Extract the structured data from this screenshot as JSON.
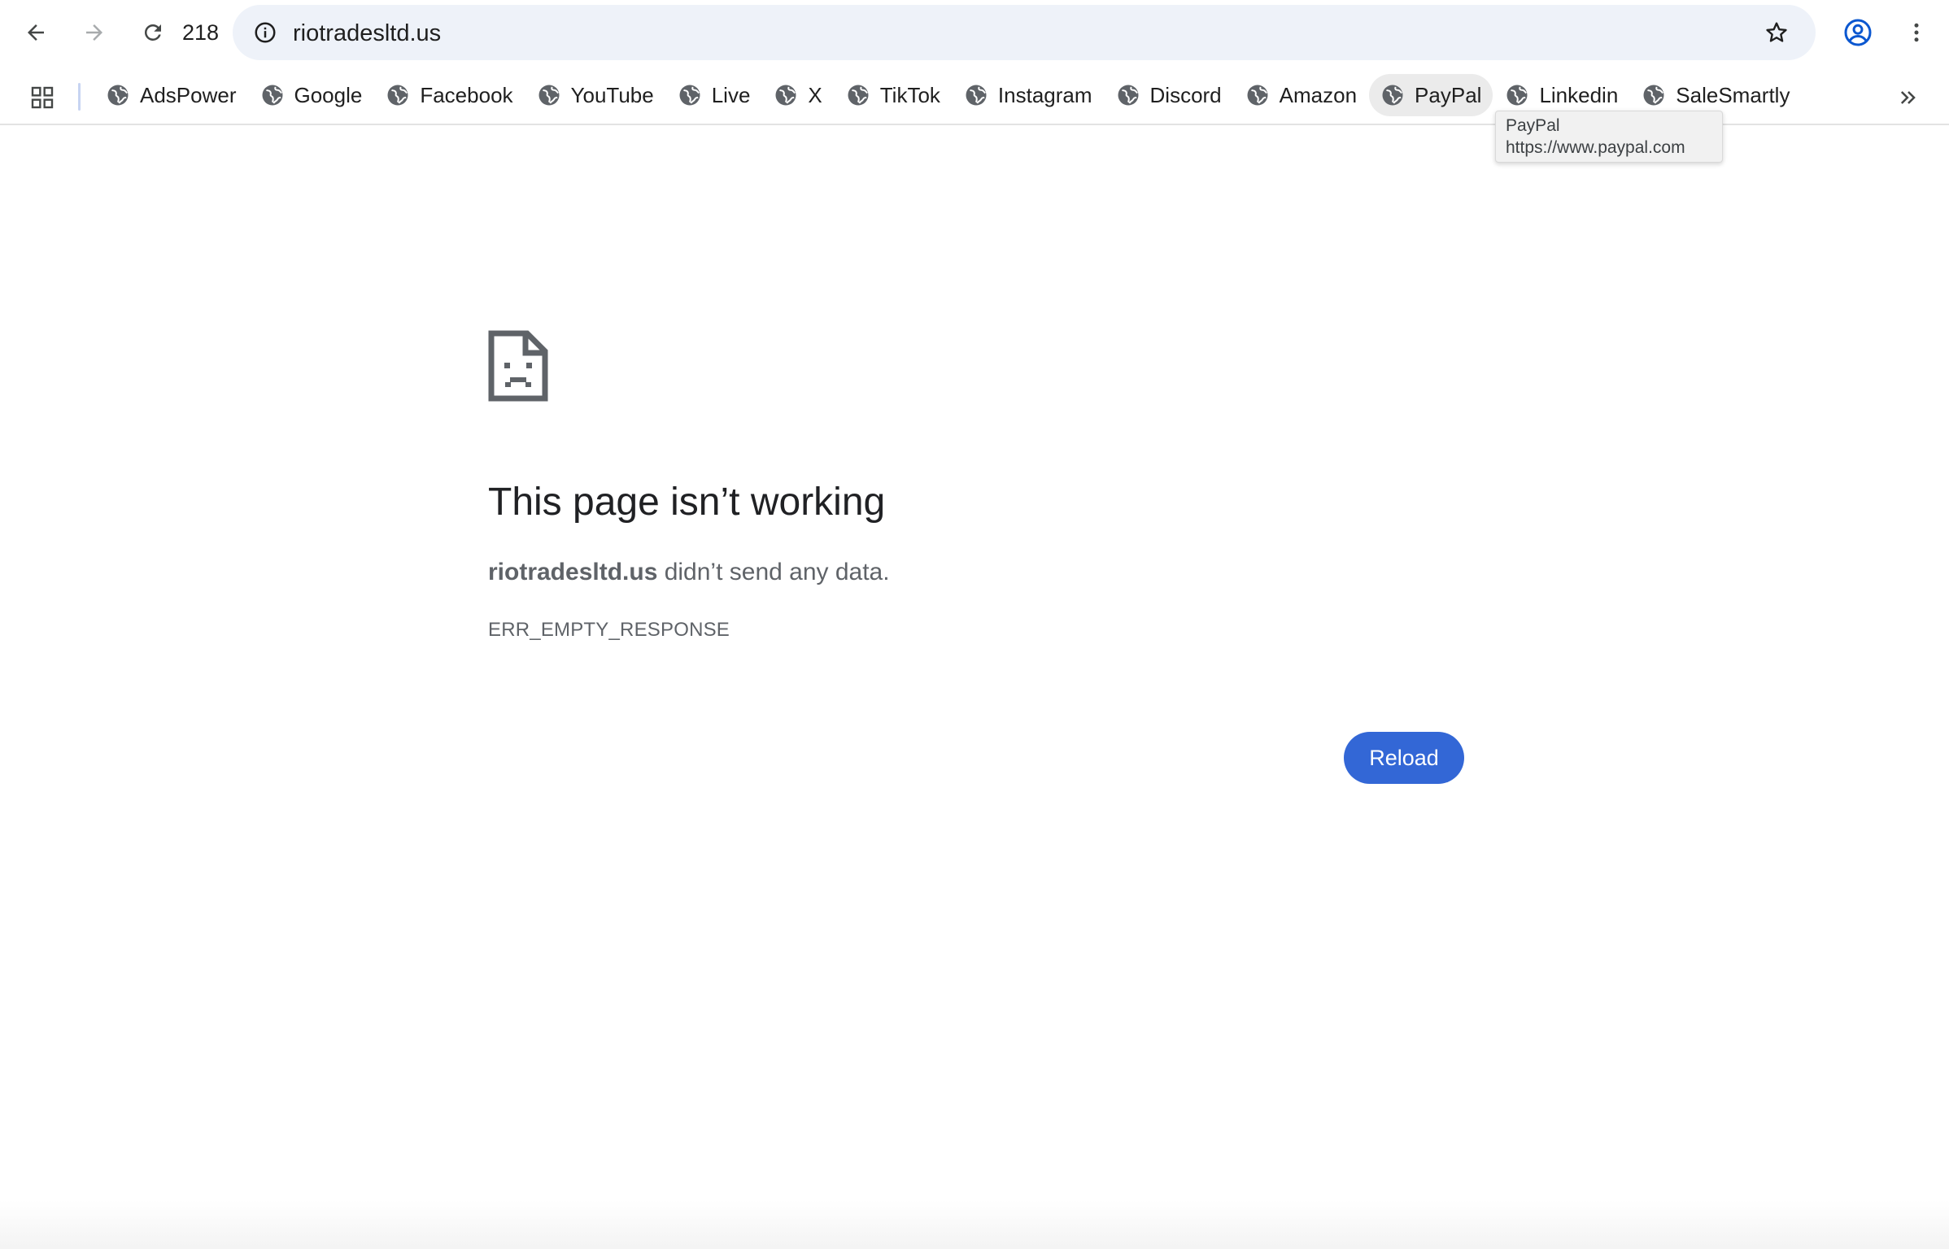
{
  "toolbar": {
    "back_icon": "arrow-left-icon",
    "forward_icon": "arrow-right-icon",
    "reload_icon": "reload-icon",
    "counter": "218",
    "url": "riotradesltd.us",
    "site_info_icon": "info-icon",
    "bookmark_star_icon": "star-icon",
    "profile_icon": "account-icon",
    "menu_icon": "kebab-menu-icon"
  },
  "bookmarks": {
    "apps_icon": "apps-grid-icon",
    "items": [
      {
        "label": "AdsPower"
      },
      {
        "label": "Google"
      },
      {
        "label": "Facebook"
      },
      {
        "label": "YouTube"
      },
      {
        "label": "Live"
      },
      {
        "label": "X"
      },
      {
        "label": "TikTok"
      },
      {
        "label": "Instagram"
      },
      {
        "label": "Discord"
      },
      {
        "label": "Amazon"
      },
      {
        "label": "PayPal"
      },
      {
        "label": "Linkedin"
      },
      {
        "label": "SaleSmartly"
      }
    ],
    "hovered_index": 10,
    "more_icon": "double-chevron-right-icon"
  },
  "tooltip": {
    "title": "PayPal",
    "url": "https://www.paypal.com"
  },
  "error": {
    "icon": "sad-page-icon",
    "title": "This page isn’t working",
    "host": "riotradesltd.us",
    "message": " didn’t send any data.",
    "code": "ERR_EMPTY_RESPONSE",
    "reload_label": "Reload"
  },
  "colors": {
    "accent": "#3367d6",
    "omnibox_bg": "#eef2f9",
    "profile": "#0b57d0"
  }
}
